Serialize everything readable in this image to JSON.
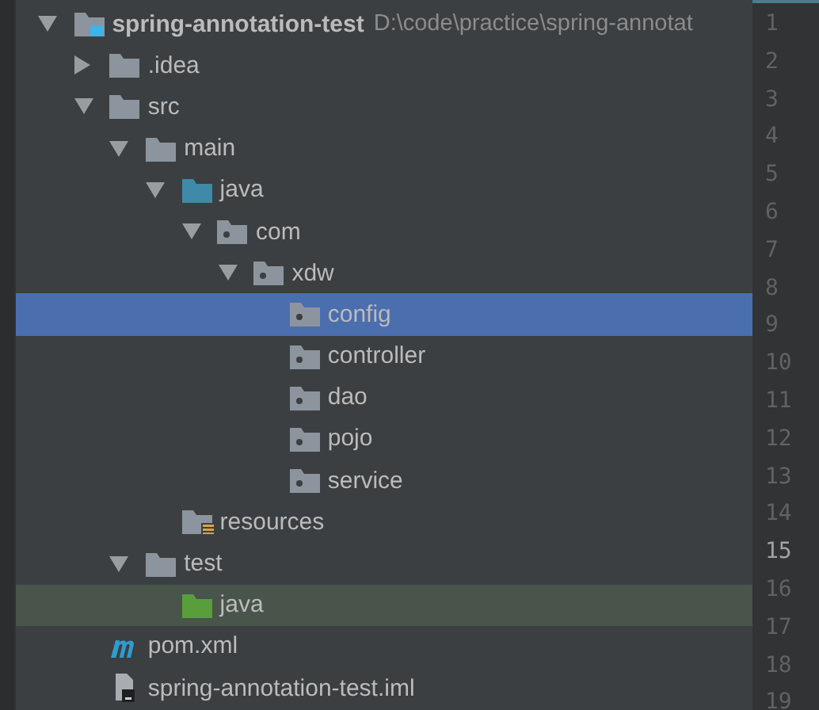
{
  "project_tree": [
    {
      "kind": "project",
      "label": "spring-annotation-test",
      "path": "D:\\code\\practice\\spring-annotat",
      "expanded": true,
      "selected": false,
      "highlighted": false,
      "children": [
        {
          "kind": "folder",
          "label": ".idea",
          "expanded": false,
          "selected": false,
          "highlighted": false
        },
        {
          "kind": "folder",
          "label": "src",
          "expanded": true,
          "selected": false,
          "highlighted": false,
          "children": [
            {
              "kind": "folder",
              "label": "main",
              "expanded": true,
              "selected": false,
              "highlighted": false,
              "children": [
                {
                  "kind": "source-root",
                  "label": "java",
                  "expanded": true,
                  "selected": false,
                  "highlighted": false,
                  "children": [
                    {
                      "kind": "package",
                      "label": "com",
                      "expanded": true,
                      "selected": false,
                      "highlighted": false,
                      "children": [
                        {
                          "kind": "package",
                          "label": "xdw",
                          "expanded": true,
                          "selected": false,
                          "highlighted": false,
                          "children": [
                            {
                              "kind": "package",
                              "label": "config",
                              "selected": true,
                              "highlighted": false
                            },
                            {
                              "kind": "package",
                              "label": "controller",
                              "selected": false,
                              "highlighted": false
                            },
                            {
                              "kind": "package",
                              "label": "dao",
                              "selected": false,
                              "highlighted": false
                            },
                            {
                              "kind": "package",
                              "label": "pojo",
                              "selected": false,
                              "highlighted": false
                            },
                            {
                              "kind": "package",
                              "label": "service",
                              "selected": false,
                              "highlighted": false
                            }
                          ]
                        }
                      ]
                    }
                  ]
                },
                {
                  "kind": "resource-root",
                  "label": "resources",
                  "selected": false,
                  "highlighted": false
                }
              ]
            },
            {
              "kind": "folder",
              "label": "test",
              "expanded": true,
              "selected": false,
              "highlighted": false,
              "children": [
                {
                  "kind": "test-root",
                  "label": "java",
                  "selected": false,
                  "highlighted": true
                }
              ]
            }
          ]
        },
        {
          "kind": "maven",
          "label": "pom.xml",
          "selected": false,
          "highlighted": false
        },
        {
          "kind": "iml",
          "label": "spring-annotation-test.iml",
          "selected": false,
          "highlighted": false
        }
      ]
    }
  ],
  "line_numbers": [
    {
      "number": "1",
      "current": false
    },
    {
      "number": "2",
      "current": false
    },
    {
      "number": "3",
      "current": false
    },
    {
      "number": "4",
      "current": false
    },
    {
      "number": "5",
      "current": false
    },
    {
      "number": "6",
      "current": false
    },
    {
      "number": "7",
      "current": false
    },
    {
      "number": "8",
      "current": false
    },
    {
      "number": "9",
      "current": false
    },
    {
      "number": "10",
      "current": false
    },
    {
      "number": "11",
      "current": false
    },
    {
      "number": "12",
      "current": false
    },
    {
      "number": "13",
      "current": false
    },
    {
      "number": "14",
      "current": false
    },
    {
      "number": "15",
      "current": true
    },
    {
      "number": "16",
      "current": false
    },
    {
      "number": "17",
      "current": false
    },
    {
      "number": "18",
      "current": false
    },
    {
      "number": "19",
      "current": false
    }
  ]
}
